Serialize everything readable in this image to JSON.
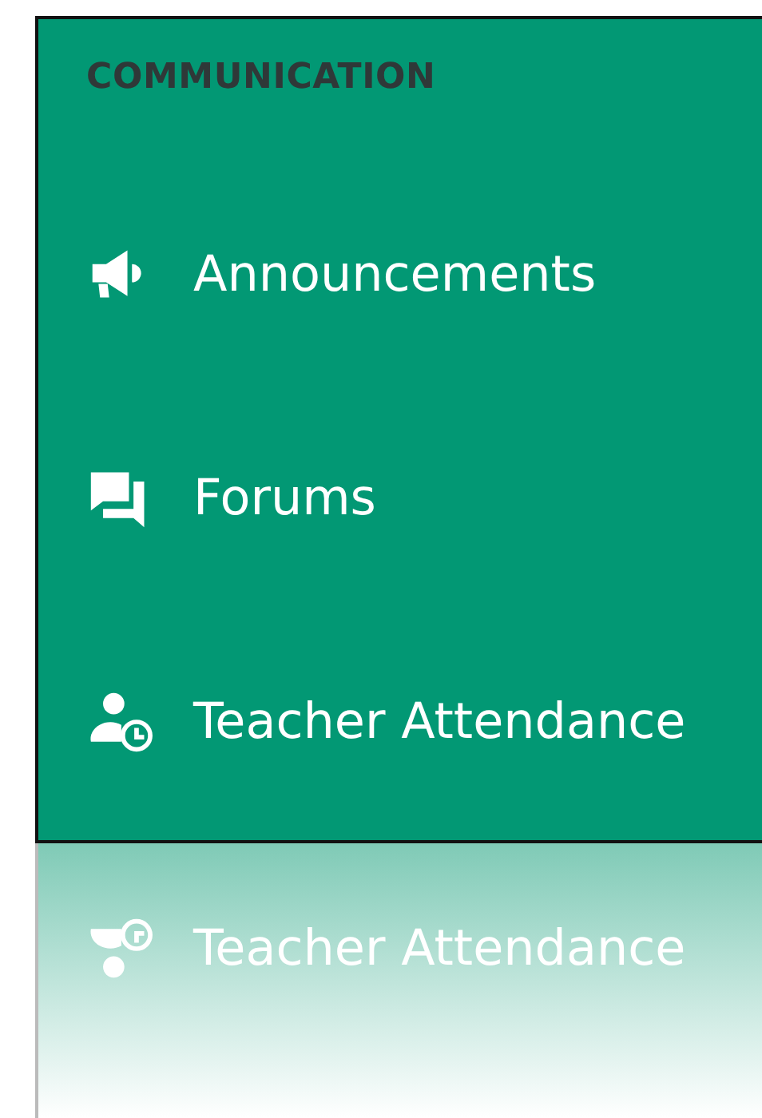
{
  "menu": {
    "heading": "COMMUNICATION",
    "items": [
      {
        "label": "Announcements",
        "kind": "megaphone"
      },
      {
        "label": "Forums",
        "kind": "chat"
      },
      {
        "label": "Teacher Attendance",
        "kind": "person-clock"
      }
    ]
  },
  "reflection": {
    "label": "Teacher Attendance",
    "kind": "person-clock"
  }
}
